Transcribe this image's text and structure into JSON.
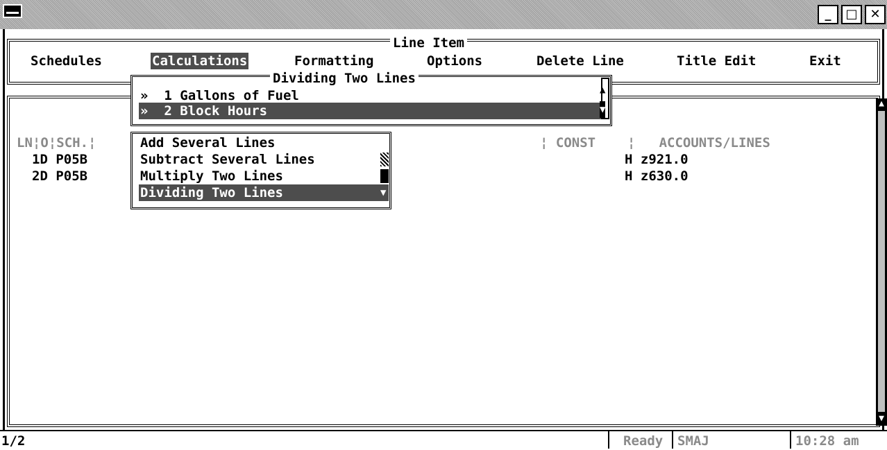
{
  "window": {
    "minimize_label": "_",
    "maximize_label": "□",
    "close_label": "✕"
  },
  "menu_bar": {
    "title": "Line Item",
    "items": [
      "Schedules",
      "Calculations",
      "Formatting",
      "Options",
      "Delete Line",
      "Title Edit",
      "Exit"
    ],
    "active": "Calculations"
  },
  "sub_popup": {
    "title": "Dividing Two Lines",
    "items": [
      {
        "marker": "»",
        "number": "1",
        "label": "Gallons of Fuel",
        "selected": false
      },
      {
        "marker": "»",
        "number": "2",
        "label": "Block Hours",
        "selected": true
      }
    ]
  },
  "calc_popup": {
    "items": [
      {
        "label": "Add Several Lines",
        "selected": false
      },
      {
        "label": "Subtract Several Lines",
        "selected": false
      },
      {
        "label": "Multiply Two Lines",
        "selected": false
      },
      {
        "label": "Dividing Two Lines",
        "selected": true
      }
    ]
  },
  "table": {
    "headers": {
      "ln": "LN",
      "o": "O",
      "sch": "SCH.",
      "const": "CONST",
      "accounts": "ACCOUNTS/LINES"
    },
    "rows": [
      {
        "ln": "1",
        "o": "D",
        "sch": "P05B",
        "code": "H",
        "account": "z921.0"
      },
      {
        "ln": "2",
        "o": "D",
        "sch": "P05B",
        "code": "H",
        "account": "z630.0"
      }
    ]
  },
  "status": {
    "position": "1/2",
    "state": "Ready",
    "user": "SMAJ",
    "time": "10:28 am"
  },
  "colors": {
    "highlight": "#4d4d4d",
    "background": "#ffffff",
    "text": "#000000",
    "dim_text": "#8a8a8a"
  }
}
